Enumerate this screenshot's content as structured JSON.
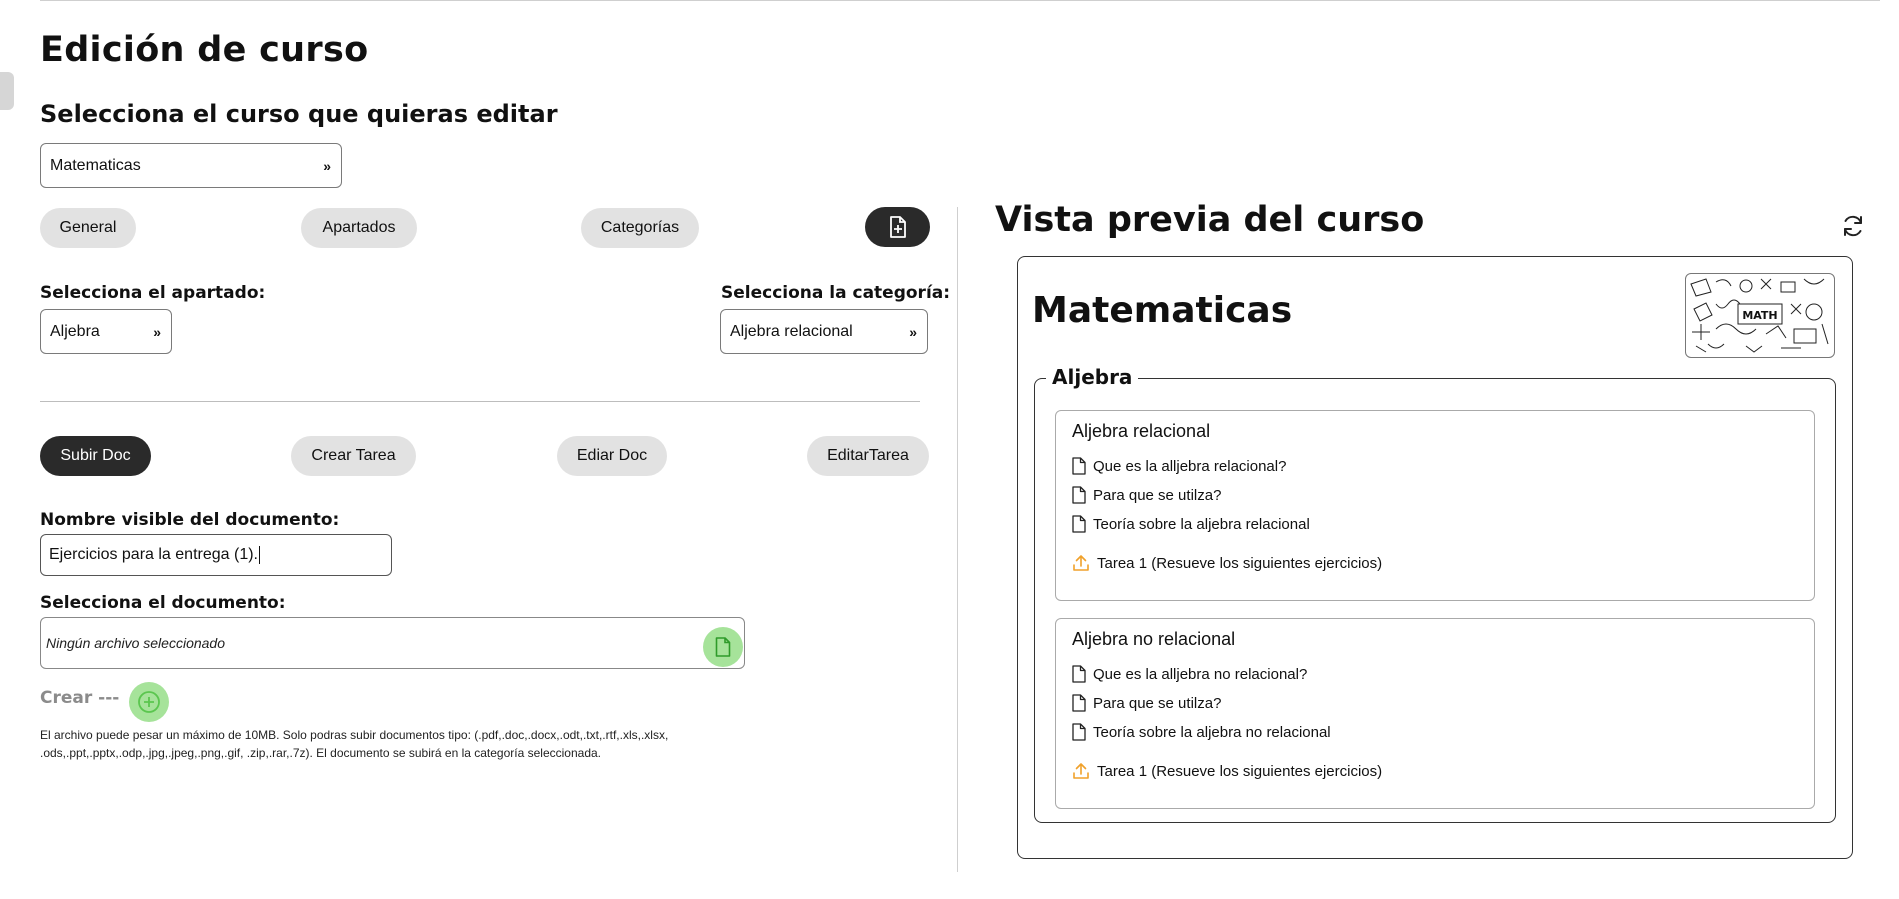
{
  "page": {
    "title": "Edición de curso",
    "subtitle": "Selecciona el curso que quieras editar",
    "course_select": "Matematicas"
  },
  "top_tabs": {
    "general": "General",
    "apartados": "Apartados",
    "categorias": "Categorías"
  },
  "selectors": {
    "apartado_label": "Selecciona el apartado:",
    "apartado_value": "Aljebra",
    "categoria_label": "Selecciona la categoría:",
    "categoria_value": "Aljebra relacional"
  },
  "actions": {
    "subir_doc": "Subir Doc",
    "crear_tarea": "Crear Tarea",
    "editar_doc": "Ediar Doc",
    "editar_tarea": "EditarTarea"
  },
  "form": {
    "name_label": "Nombre visible del documento:",
    "name_value": "Ejercicios para la entrega (1).",
    "doc_label": "Selecciona el documento:",
    "file_placeholder": "Ningún archivo seleccionado",
    "crear_label": "Crear ---",
    "note_line1": "El archivo puede pesar un máximo de 10MB. Solo podras subir documentos tipo: (.pdf,.doc,.docx,.odt,.txt,.rtf,.xls,.xlsx,",
    "note_line2": ".ods,.ppt,.pptx,.odp,.jpg,.jpeg,.png,.gif, .zip,.rar,.7z). El documento se subirá en la categoría seleccionada."
  },
  "preview": {
    "title": "Vista previa del curso",
    "course_name": "Matematicas",
    "thumbnail_text": "MATH",
    "section": "Aljebra",
    "categories": [
      {
        "title": "Aljebra relacional",
        "docs": [
          "Que es la alljebra relacional?",
          "Para que se utilza?",
          "Teoría sobre la aljebra relacional"
        ],
        "task": "Tarea 1 (Resueve los siguientes ejercicios)"
      },
      {
        "title": "Aljebra no relacional",
        "docs": [
          "Que es la alljebra no relacional?",
          "Para que se utilza?",
          "Teoría sobre la aljebra no relacional"
        ],
        "task": "Tarea 1 (Resueve los siguientes ejercicios)"
      }
    ]
  },
  "colors": {
    "dark_button": "#2a2a2a",
    "pill": "#e2e2e2",
    "green": "#a6e39a",
    "task_icon": "#f0a12b"
  }
}
